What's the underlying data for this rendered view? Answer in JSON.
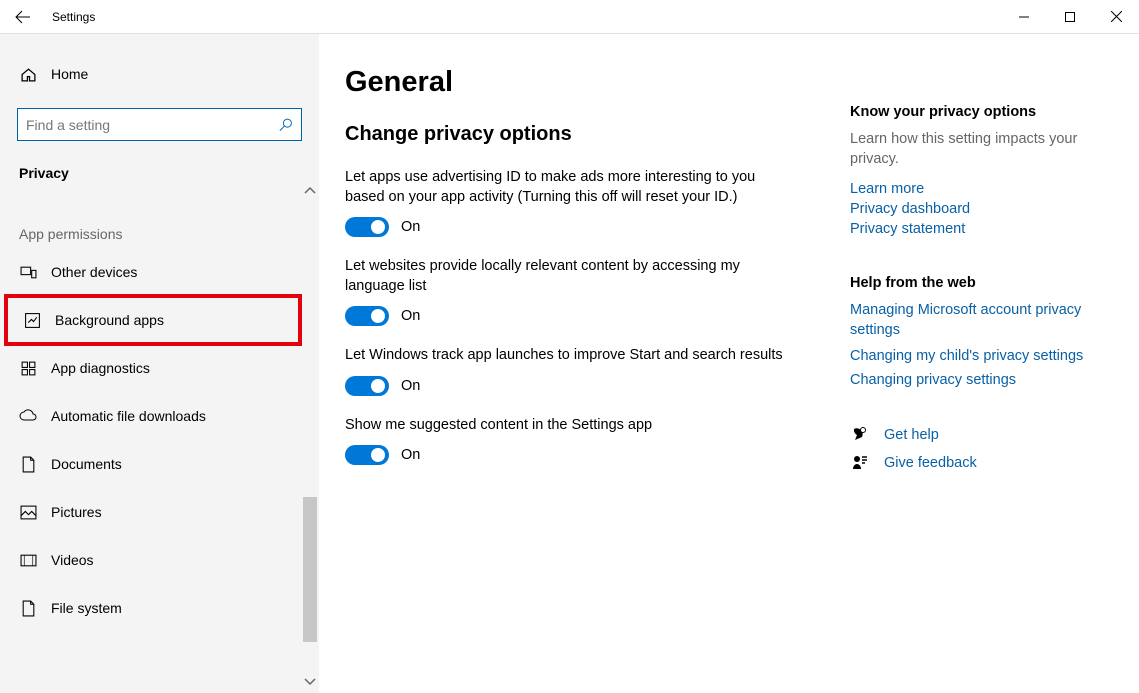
{
  "titlebar": {
    "title": "Settings"
  },
  "sidebar": {
    "home": "Home",
    "search_placeholder": "Find a setting",
    "category": "Privacy",
    "section": "App permissions",
    "items": [
      {
        "label": "Other devices"
      },
      {
        "label": "Background apps"
      },
      {
        "label": "App diagnostics"
      },
      {
        "label": "Automatic file downloads"
      },
      {
        "label": "Documents"
      },
      {
        "label": "Pictures"
      },
      {
        "label": "Videos"
      },
      {
        "label": "File system"
      }
    ]
  },
  "main": {
    "title": "General",
    "subheading": "Change privacy options",
    "options": [
      {
        "desc": "Let apps use advertising ID to make ads more interesting to you based on your app activity (Turning this off will reset your ID.)",
        "state": "On"
      },
      {
        "desc": "Let websites provide locally relevant content by accessing my language list",
        "state": "On"
      },
      {
        "desc": "Let Windows track app launches to improve Start and search results",
        "state": "On"
      },
      {
        "desc": "Show me suggested content in the Settings app",
        "state": "On"
      }
    ]
  },
  "side": {
    "know": {
      "title": "Know your privacy options",
      "desc": "Learn how this setting impacts your privacy.",
      "links": [
        "Learn more",
        "Privacy dashboard",
        "Privacy statement"
      ]
    },
    "help": {
      "title": "Help from the web",
      "links": [
        "Managing Microsoft account privacy settings",
        "Changing my child's privacy settings",
        "Changing privacy settings"
      ]
    },
    "actions": {
      "gethelp": "Get help",
      "feedback": "Give feedback"
    }
  }
}
